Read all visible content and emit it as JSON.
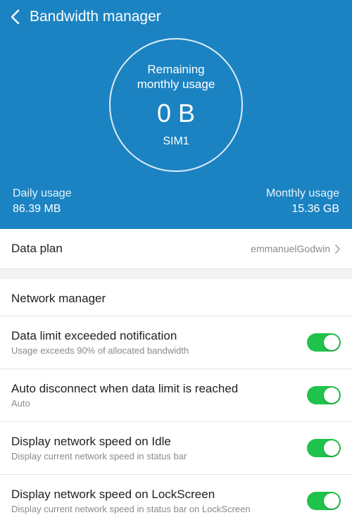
{
  "header": {
    "title": "Bandwidth manager",
    "ring": {
      "remaining_label": "Remaining\nmonthly usage",
      "amount": "0 B",
      "sim": "SIM1"
    },
    "daily": {
      "label": "Daily usage",
      "value": "86.39 MB"
    },
    "monthly": {
      "label": "Monthly usage",
      "value": "15.36 GB"
    }
  },
  "data_plan": {
    "title": "Data plan",
    "value": "emmanuelGodwin"
  },
  "network_manager": {
    "header": "Network manager",
    "items": [
      {
        "title": "Data limit exceeded notification",
        "sub": "Usage exceeds 90% of allocated bandwidth",
        "on": true
      },
      {
        "title": "Auto disconnect when data limit is reached",
        "sub": "Auto",
        "on": true
      },
      {
        "title": "Display network speed on Idle",
        "sub": "Display current network speed in status bar",
        "on": true
      },
      {
        "title": "Display network speed on LockScreen",
        "sub": "Display current network speed in status bar on LockScreen",
        "on": true
      }
    ]
  },
  "colors": {
    "header_bg": "#1b83c2",
    "toggle_on": "#1fc24a"
  }
}
